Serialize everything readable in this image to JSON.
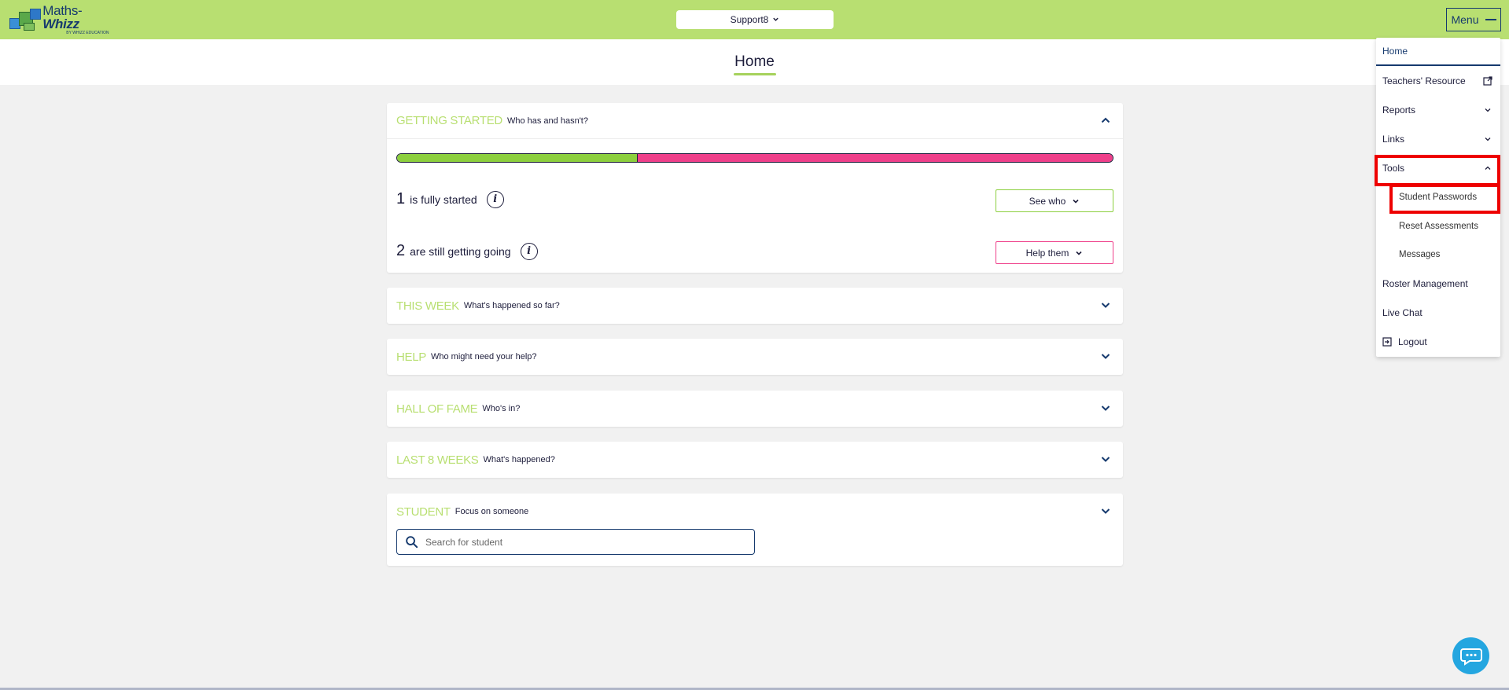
{
  "app": {
    "logo_text_bold": "Maths-",
    "logo_text_italic": "Whizz",
    "logo_sub": "by whizz education",
    "class_selector": "Support8",
    "menu_label": "Menu"
  },
  "page": {
    "title": "Home"
  },
  "cards": {
    "getting_started": {
      "keyword": "GETTING STARTED",
      "subtitle": "Who has and hasn't?",
      "progress_fraction": 0.336,
      "stat1_num": "1",
      "stat1_text": "is fully started",
      "stat1_button": "See who",
      "stat2_num": "2",
      "stat2_text": "are still getting going",
      "stat2_button": "Help them"
    },
    "this_week": {
      "keyword": "THIS WEEK",
      "subtitle": "What's happened so far?"
    },
    "help": {
      "keyword": "HELP",
      "subtitle": "Who might need your help?"
    },
    "hall_of_fame": {
      "keyword": "HALL OF FAME",
      "subtitle": "Who's in?"
    },
    "last_8_weeks": {
      "keyword": "LAST 8 WEEKS",
      "subtitle": "What's happened?"
    },
    "student": {
      "keyword": "STUDENT",
      "subtitle": "Focus on someone",
      "search_placeholder": "Search for student"
    }
  },
  "menu": {
    "items": [
      {
        "label": "Home"
      },
      {
        "label": "Teachers' Resource"
      },
      {
        "label": "Reports"
      },
      {
        "label": "Links"
      },
      {
        "label": "Tools"
      },
      {
        "label": "Student Passwords"
      },
      {
        "label": "Reset Assessments"
      },
      {
        "label": "Messages"
      },
      {
        "label": "Roster Management"
      },
      {
        "label": "Live Chat"
      },
      {
        "label": "Logout"
      }
    ]
  },
  "colors": {
    "brand_green": "#b8df71",
    "progress_green": "#8ccf3e",
    "progress_pink": "#ef3f8a",
    "navy": "#163a6e",
    "highlight_red": "#ee0000",
    "chat_blue": "#24a6e0"
  },
  "icons": {
    "chevron_up": "chevron-up-icon",
    "chevron_down": "chevron-down-icon",
    "info": "info-icon",
    "search": "search-icon",
    "external_link": "external-link-icon",
    "logout": "logout-icon",
    "chat": "chat-icon",
    "hamburger": "hamburger-icon"
  }
}
